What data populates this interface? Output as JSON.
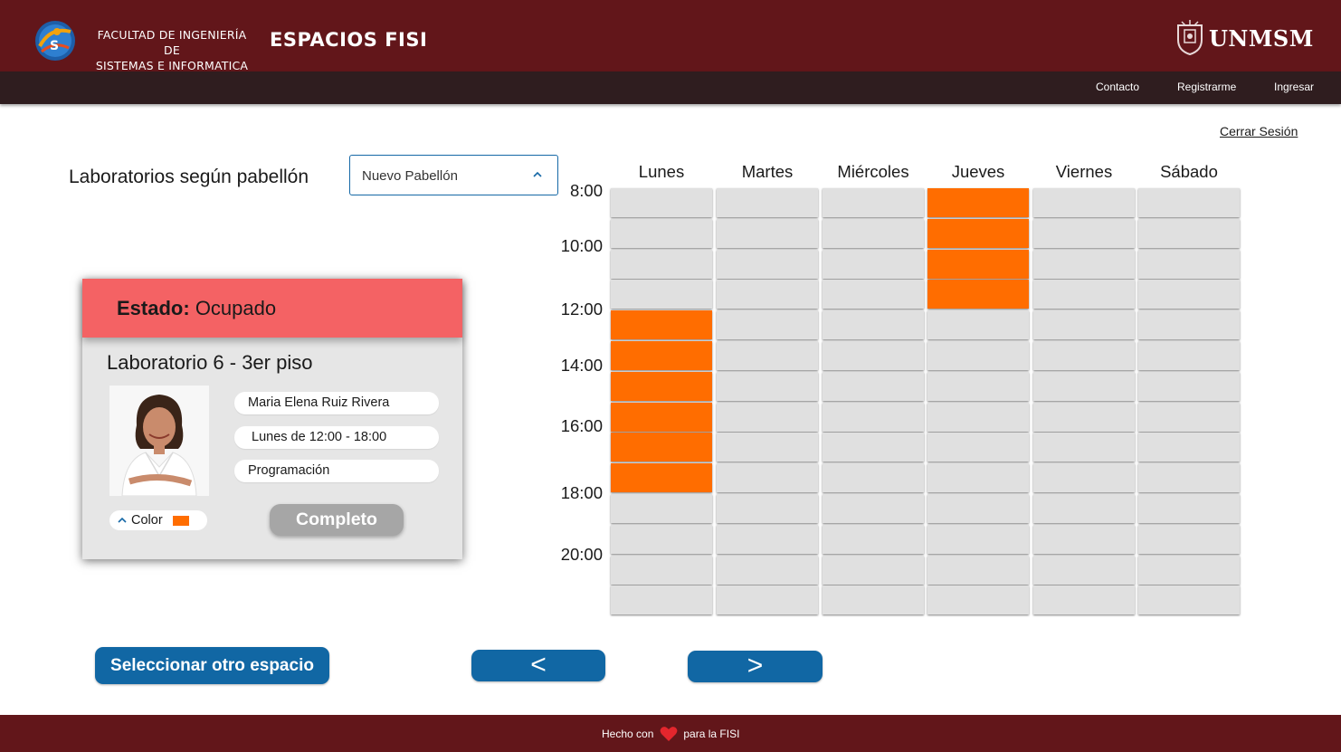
{
  "header": {
    "faculty_line1": "FACULTAD DE INGENIERÍA DE",
    "faculty_line2": "SISTEMAS E INFORMATICA",
    "app_title": "ESPACIOS FISI",
    "university": "UNMSM",
    "brand_color": "#62161a"
  },
  "nav": {
    "contact": "Contacto",
    "register": "Registrarme",
    "login": "Ingresar"
  },
  "logout": "Cerrar Sesión",
  "filter": {
    "label": "Laboratorios según pabellón",
    "selected": "Nuevo Pabellón"
  },
  "card": {
    "state_key": "Estado:",
    "state_value": "Ocupado",
    "lab_name": "Laboratorio 6 - 3er piso",
    "teacher": "Maria Elena Ruiz Rivera",
    "schedule": "Lunes de 12:00 - 18:00",
    "course": "Programación",
    "color_label": "Color",
    "color_value": "#ff6d00",
    "complete_button": "Completo",
    "header_color": "#f46264"
  },
  "schedule": {
    "days": [
      "Lunes",
      "Martes",
      "Miércoles",
      "Jueves",
      "Viernes",
      "Sábado"
    ],
    "time_labels": [
      "8:00",
      "10:00",
      "12:00",
      "14:00",
      "16:00",
      "18:00",
      "20:00"
    ],
    "rows": 14,
    "busy_color": "#ff6d00",
    "free_color": "#e0e0e0",
    "busy": {
      "Lunes": [
        4,
        5,
        6,
        7,
        8,
        9
      ],
      "Jueves": [
        0,
        1,
        2,
        3
      ]
    }
  },
  "buttons": {
    "other_space": "Seleccionar otro espacio",
    "prev": "<",
    "next": ">"
  },
  "footer": {
    "made_with": "Hecho con",
    "for_fisi": "para la FISI"
  }
}
